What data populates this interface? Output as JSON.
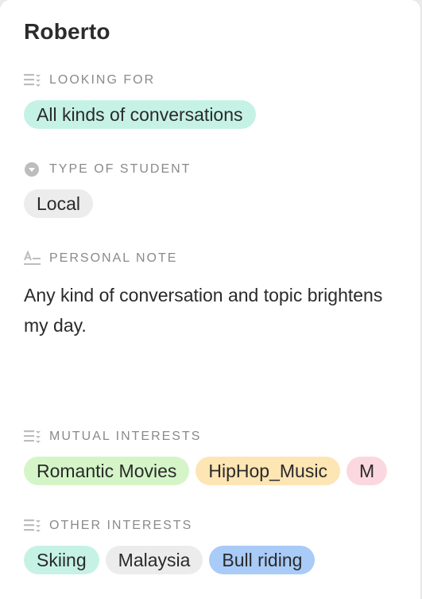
{
  "profile": {
    "name": "Roberto"
  },
  "looking_for": {
    "label": "LOOKING FOR",
    "icon": "multi-select-icon",
    "tags": [
      {
        "text": "All kinds of conversations",
        "color": "#c6f2e6"
      }
    ]
  },
  "student_type": {
    "label": "TYPE OF STUDENT",
    "icon": "single-select-icon",
    "tags": [
      {
        "text": "Local",
        "color": "#ececec"
      }
    ]
  },
  "personal_note": {
    "label": "PERSONAL NOTE",
    "icon": "text-field-icon",
    "text": "Any kind of conversation and topic brightens my day."
  },
  "mutual_interests": {
    "label": "MUTUAL INTERESTS",
    "icon": "multi-select-icon",
    "tags": [
      {
        "text": "Romantic Movies",
        "color": "#d5f5c8"
      },
      {
        "text": "HipHop_Music",
        "color": "#fde5b4"
      },
      {
        "text": "M",
        "color": "#fbd8df"
      }
    ]
  },
  "other_interests": {
    "label": "OTHER INTERESTS",
    "icon": "multi-select-icon",
    "tags": [
      {
        "text": "Skiing",
        "color": "#c6f2e6"
      },
      {
        "text": "Malaysia",
        "color": "#ececec"
      },
      {
        "text": "Bull riding",
        "color": "#a9cbf7"
      }
    ]
  }
}
